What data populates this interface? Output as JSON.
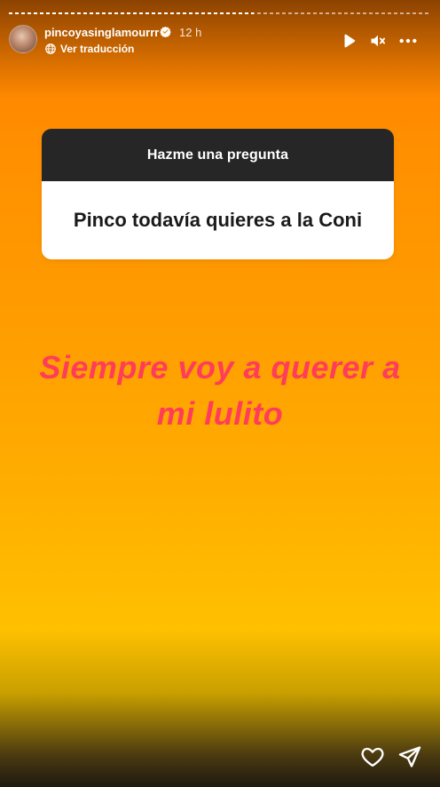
{
  "story": {
    "progress_fraction": 0.58,
    "user": {
      "username": "pincoyasinglamourrr",
      "verified_icon": "verified-badge-icon",
      "time_ago": "12 h",
      "translate_label": "Ver traducción",
      "translate_icon": "globe-icon"
    },
    "controls": {
      "play_icon": "play-icon",
      "mute_icon": "mute-icon",
      "more_icon": "more-icon"
    },
    "question_sticker": {
      "title": "Hazme una pregunta",
      "question": "Pinco todavía quieres a la Coni"
    },
    "answer_lines": [
      "Siempre voy a querer a",
      "mi lulito"
    ],
    "actions": {
      "like_icon": "heart-icon",
      "share_icon": "send-icon"
    },
    "colors": {
      "answer_text": "#ff3d5a",
      "sticker_header": "#262626",
      "gradient_top": "#ff7a00",
      "gradient_bottom": "#ffc000"
    }
  }
}
